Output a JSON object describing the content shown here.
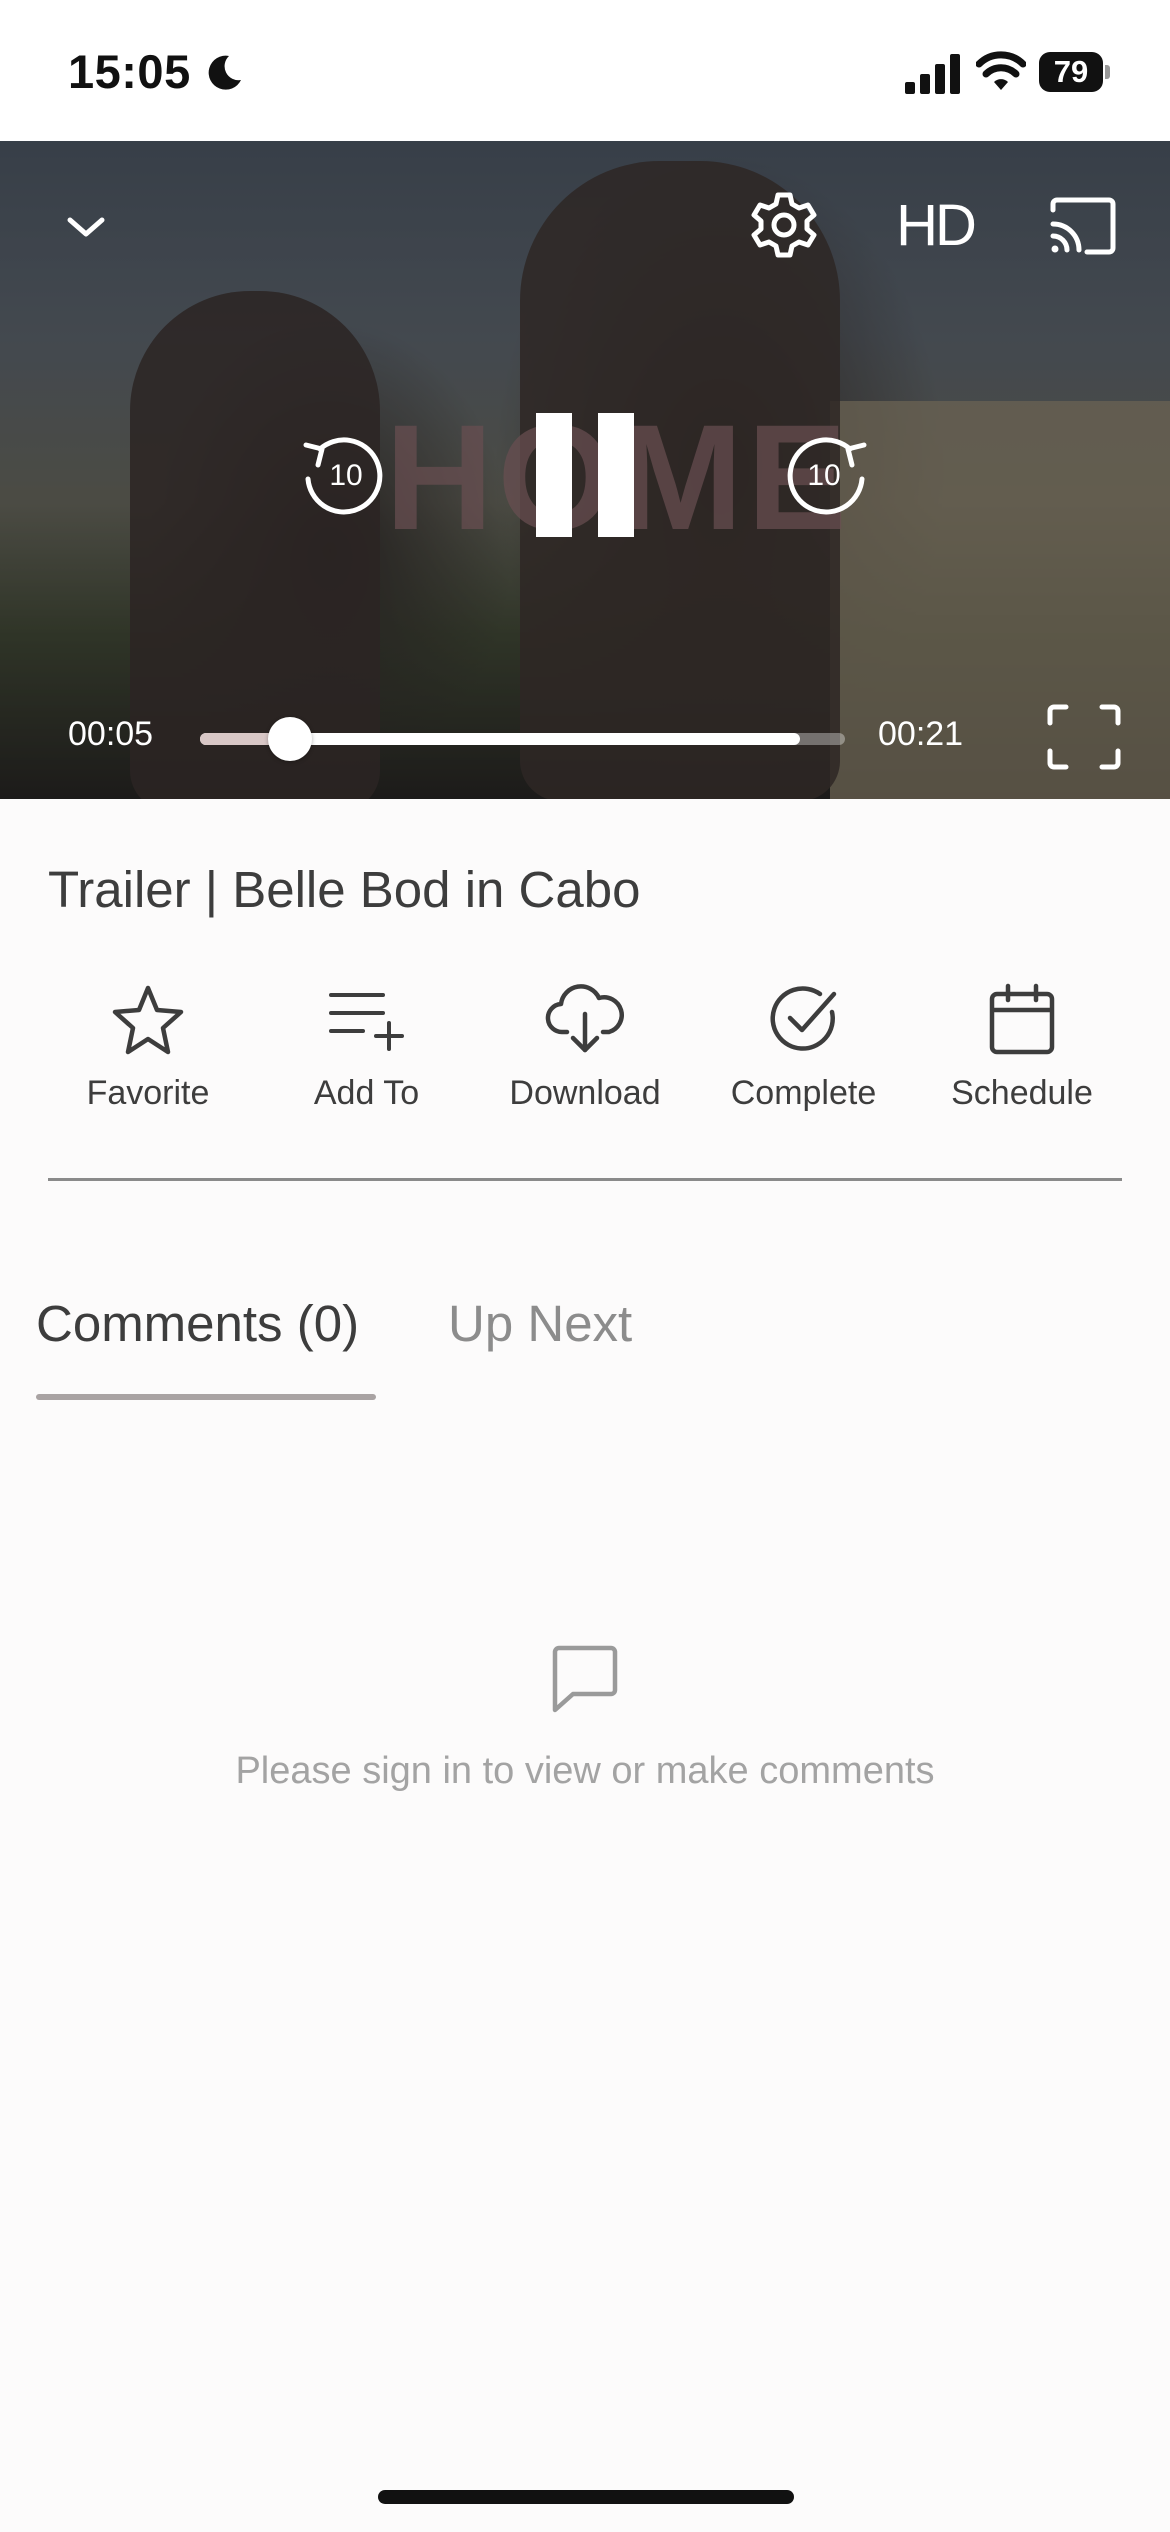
{
  "status_bar": {
    "time": "15:05",
    "battery_level": "79"
  },
  "player": {
    "watermark": "HOME",
    "quality_label": "HD",
    "rewind_seconds": "10",
    "forward_seconds": "10",
    "current_time": "00:05",
    "total_time": "00:21",
    "played_fraction": 0.14,
    "buffered_fraction": 0.93
  },
  "video": {
    "title": "Trailer | Belle Bod in Cabo"
  },
  "actions": [
    {
      "label": "Favorite",
      "icon": "star-icon"
    },
    {
      "label": "Add To",
      "icon": "playlist-add-icon"
    },
    {
      "label": "Download",
      "icon": "cloud-download-icon"
    },
    {
      "label": "Complete",
      "icon": "check-circle-icon"
    },
    {
      "label": "Schedule",
      "icon": "calendar-icon"
    }
  ],
  "tabs": {
    "comments": "Comments (0)",
    "up_next": "Up Next"
  },
  "comments": {
    "empty_message": "Please sign in to view or make comments",
    "icon": "comment-icon"
  }
}
